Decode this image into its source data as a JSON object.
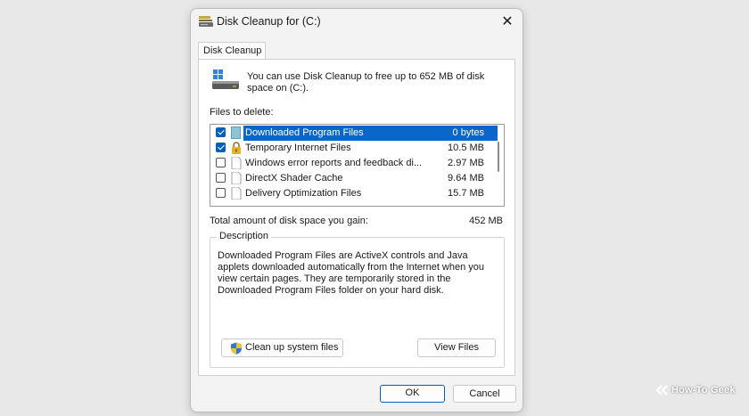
{
  "window": {
    "title": "Disk Cleanup for  (C:)",
    "close_glyph": "✕"
  },
  "tab": {
    "label": "Disk Cleanup"
  },
  "summary": "You can use Disk Cleanup to free up to 652 MB of disk space on  (C:).",
  "files_label": "Files to delete:",
  "files": [
    {
      "name": "Downloaded Program Files",
      "size": "0 bytes",
      "checked": true,
      "selected": true,
      "icon": "folder-icon"
    },
    {
      "name": "Temporary Internet Files",
      "size": "10.5 MB",
      "checked": true,
      "selected": false,
      "icon": "lock-icon"
    },
    {
      "name": "Windows error reports and feedback di...",
      "size": "2.97 MB",
      "checked": false,
      "selected": false,
      "icon": "file-icon"
    },
    {
      "name": "DirectX Shader Cache",
      "size": "9.64 MB",
      "checked": false,
      "selected": false,
      "icon": "file-icon"
    },
    {
      "name": "Delivery Optimization Files",
      "size": "15.7 MB",
      "checked": false,
      "selected": false,
      "icon": "file-icon"
    }
  ],
  "total": {
    "label": "Total amount of disk space you gain:",
    "value": "452 MB"
  },
  "description": {
    "legend": "Description",
    "text": "Downloaded Program Files are ActiveX controls and Java applets downloaded automatically from the Internet when you view certain pages. They are temporarily stored in the Downloaded Program Files folder on your hard disk."
  },
  "buttons": {
    "cleanup_system": "Clean up system files",
    "view_files": "View Files",
    "ok": "OK",
    "cancel": "Cancel"
  },
  "watermark": "How-To Geek",
  "colors": {
    "accent": "#005fb8",
    "selection": "#0a66c8"
  }
}
